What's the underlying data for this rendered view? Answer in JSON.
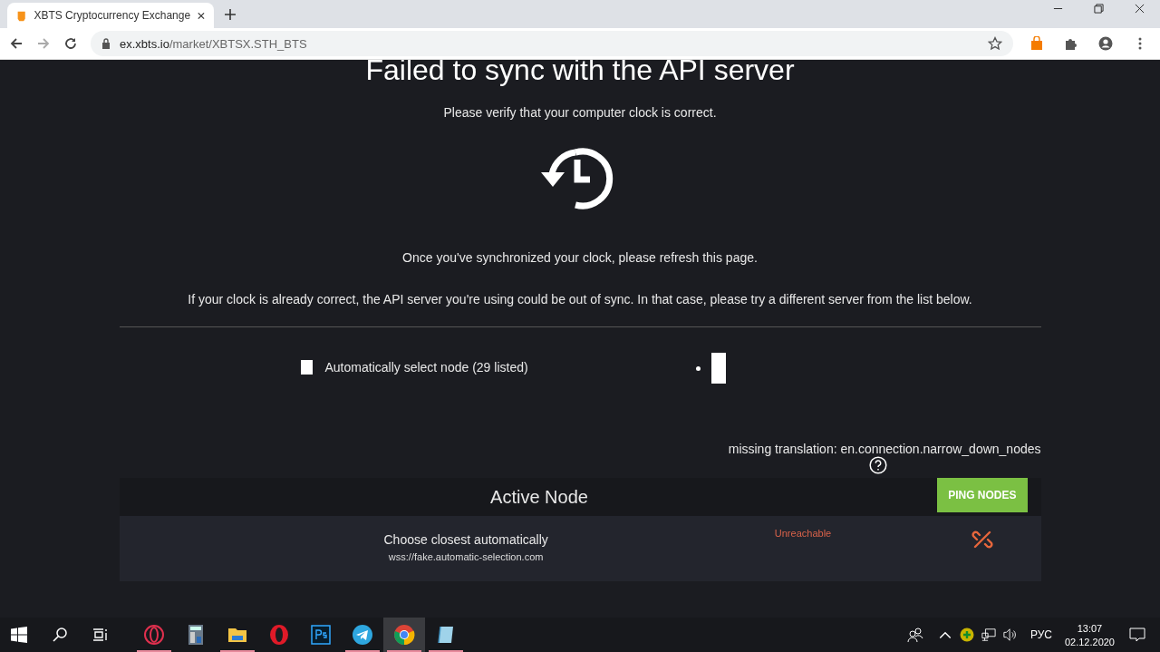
{
  "browser": {
    "tab": {
      "title": "XBTS Cryptocurrency Exchange"
    },
    "address": {
      "host": "ex.xbts.io",
      "path": "/market/XBTSX.STH_BTS"
    }
  },
  "page": {
    "heading": "Failed to sync with the API server",
    "verify": "Please verify that your computer clock is correct.",
    "refresh": "Once you've synchronized your clock, please refresh this page.",
    "hint": "If your clock is already correct, the API server you're using could be out of sync. In that case, please try a different server from the list below.",
    "auto_select": {
      "label": "Automatically select node (29 listed)",
      "checked": false
    },
    "missing": "missing translation: en.connection.narrow_down_nodes",
    "active_node": {
      "title": "Active Node",
      "button": "PING NODES",
      "node": {
        "name": "Choose closest automatically",
        "url": "wss://fake.automatic-selection.com",
        "status": "Unreachable"
      }
    }
  },
  "taskbar": {
    "apps": [
      {
        "kind": "opera-gx",
        "running": true,
        "selected": false
      },
      {
        "kind": "calculator",
        "running": false,
        "selected": false
      },
      {
        "kind": "folder",
        "running": true,
        "selected": false
      },
      {
        "kind": "opera",
        "running": false,
        "selected": false
      },
      {
        "kind": "ps",
        "running": false,
        "selected": false
      },
      {
        "kind": "telegram",
        "running": true,
        "selected": false
      },
      {
        "kind": "chrome",
        "running": true,
        "selected": true
      },
      {
        "kind": "notepad",
        "running": true,
        "selected": false
      }
    ],
    "lang": "РУС",
    "time": "13:07",
    "date": "02.12.2020"
  }
}
